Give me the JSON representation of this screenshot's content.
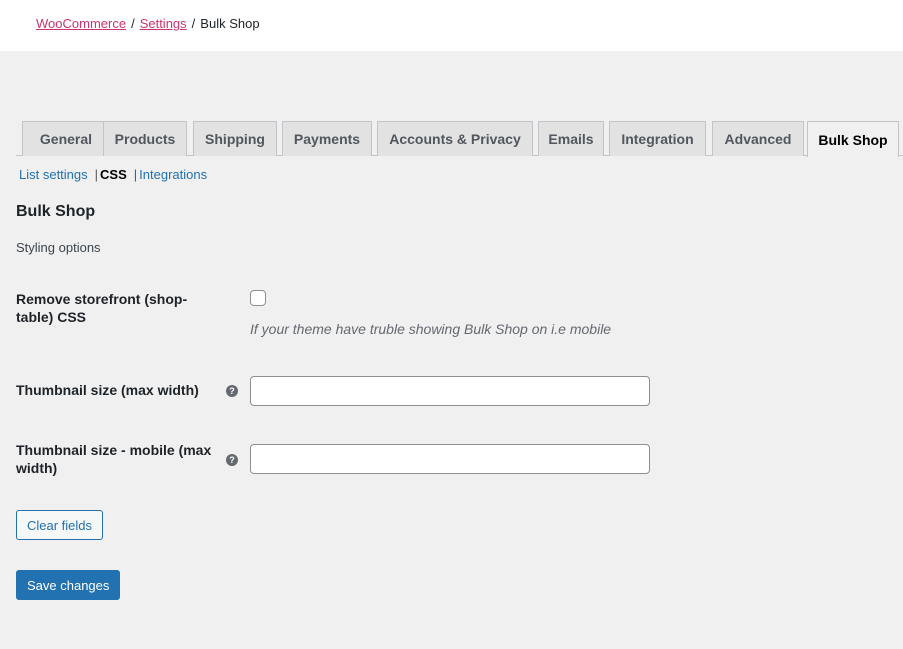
{
  "breadcrumb": {
    "items": [
      {
        "label": "WooCommerce",
        "link": true
      },
      {
        "label": "Settings",
        "link": true
      },
      {
        "label": "Bulk Shop",
        "link": false
      }
    ],
    "separator": "/"
  },
  "tabs": [
    {
      "label": "General",
      "active": false
    },
    {
      "label": "Products",
      "active": false
    },
    {
      "label": "Shipping",
      "active": false
    },
    {
      "label": "Payments",
      "active": false
    },
    {
      "label": "Accounts & Privacy",
      "active": false
    },
    {
      "label": "Emails",
      "active": false
    },
    {
      "label": "Integration",
      "active": false
    },
    {
      "label": "Advanced",
      "active": false
    },
    {
      "label": "Bulk Shop",
      "active": true
    }
  ],
  "subnav": {
    "items": [
      {
        "label": "List settings",
        "current": false
      },
      {
        "label": "CSS",
        "current": true
      },
      {
        "label": "Integrations",
        "current": false
      }
    ],
    "separator": "|"
  },
  "section": {
    "title": "Bulk Shop",
    "description": "Styling options"
  },
  "fields": {
    "remove_css": {
      "label": "Remove storefront (shop-table) CSS",
      "checked": false,
      "description": "If your theme have truble showing Bulk Shop on i.e mobile"
    },
    "thumb_size": {
      "label": "Thumbnail size (max width)",
      "value": "",
      "help_icon": "?"
    },
    "thumb_size_mobile": {
      "label": "Thumbnail size - mobile (max width)",
      "value": "",
      "help_icon": "?"
    }
  },
  "buttons": {
    "clear": "Clear fields",
    "save": "Save changes"
  },
  "colors": {
    "link": "#2271b1",
    "breadcrumb_link": "#c9356e",
    "primary": "#2271b1",
    "background": "#f0f0f1"
  }
}
